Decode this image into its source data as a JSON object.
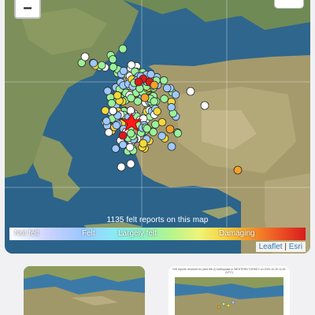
{
  "map": {
    "zoom_out_label": "−",
    "felt_reports_text": "1135 felt reports on this map",
    "legend": {
      "labels": [
        "Not felt",
        "Felt",
        "Largely felt",
        "Damaging"
      ]
    },
    "attribution": {
      "leaflet": "Leaflet",
      "separator": "|",
      "esri": "Esri"
    },
    "epicenter_symbol": "red-star",
    "colors": {
      "not_felt": "#ffffff",
      "felt": "#9ec8ff",
      "largely_felt": "#9af29a",
      "strong": "#f5d93a",
      "damaging": "#d81c1c"
    }
  },
  "thumbnails": [
    {
      "caption": ""
    },
    {
      "caption": "Felt reports received for (and M6.2) earthquake\nin WESTERN TURKEY\non 2020-10-30 11:51 (UTC)"
    }
  ]
}
